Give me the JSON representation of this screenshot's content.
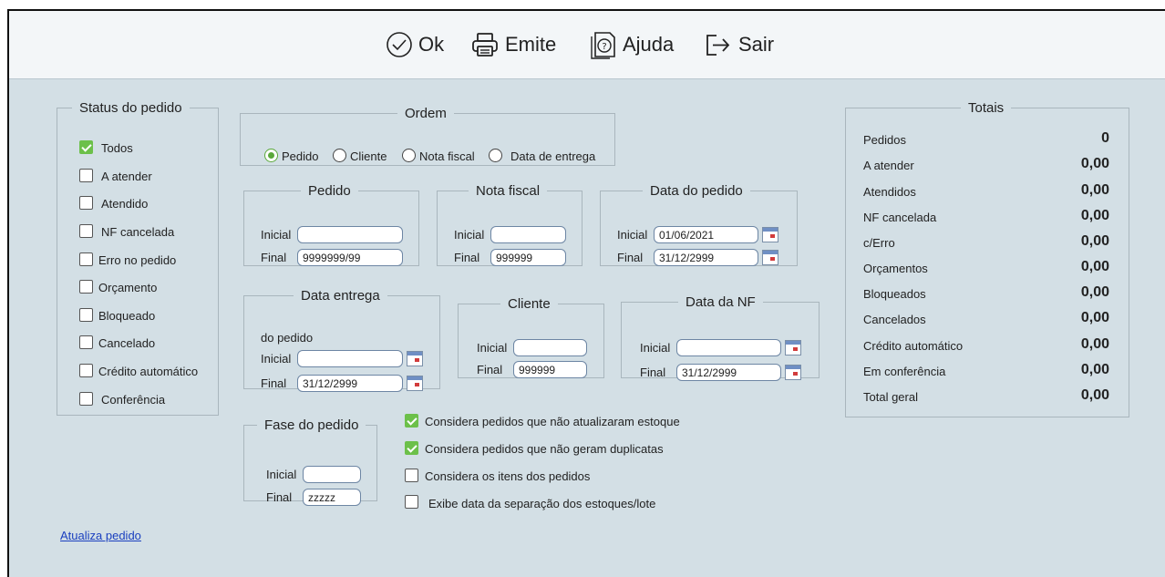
{
  "toolbar": {
    "ok": "Ok",
    "emite": "Emite",
    "ajuda": "Ajuda",
    "sair": "Sair"
  },
  "status": {
    "legend": "Status do pedido",
    "items": [
      {
        "label": "Todos",
        "checked": true
      },
      {
        "label": "A atender",
        "checked": false
      },
      {
        "label": "Atendido",
        "checked": false
      },
      {
        "label": "NF cancelada",
        "checked": false
      },
      {
        "label": "Erro no pedido",
        "checked": false
      },
      {
        "label": "Orçamento",
        "checked": false
      },
      {
        "label": "Bloqueado",
        "checked": false
      },
      {
        "label": "Cancelado",
        "checked": false
      },
      {
        "label": "Crédito automático",
        "checked": false
      },
      {
        "label": "Conferência",
        "checked": false
      }
    ]
  },
  "ordem": {
    "legend": "Ordem",
    "options": [
      "Pedido",
      "Cliente",
      "Nota fiscal",
      "Data de entrega"
    ],
    "selected": "Pedido"
  },
  "pedido": {
    "legend": "Pedido",
    "inicial_label": "Inicial",
    "final_label": "Final",
    "inicial": "",
    "final": "9999999/99"
  },
  "nota_fiscal": {
    "legend": "Nota fiscal",
    "inicial_label": "Inicial",
    "final_label": "Final",
    "inicial": "",
    "final": "999999"
  },
  "data_pedido": {
    "legend": "Data do pedido",
    "inicial_label": "Inicial",
    "final_label": "Final",
    "inicial": "01/06/2021",
    "final": "31/12/2999"
  },
  "data_entrega": {
    "legend": "Data entrega",
    "sub_label": "do pedido",
    "inicial_label": "Inicial",
    "final_label": "Final",
    "inicial": "",
    "final": "31/12/2999"
  },
  "cliente": {
    "legend": "Cliente",
    "inicial_label": "Inicial",
    "final_label": "Final",
    "inicial": "",
    "final": "999999"
  },
  "data_nf": {
    "legend": "Data da NF",
    "inicial_label": "Inicial",
    "final_label": "Final",
    "inicial": "",
    "final": "31/12/2999"
  },
  "fase": {
    "legend": "Fase do pedido",
    "inicial_label": "Inicial",
    "final_label": "Final",
    "inicial": "",
    "final": "zzzzz"
  },
  "options": [
    {
      "label": "Considera pedidos que não atualizaram estoque",
      "checked": true
    },
    {
      "label": "Considera pedidos que não geram duplicatas",
      "checked": true
    },
    {
      "label": "Considera os itens dos pedidos",
      "checked": false
    },
    {
      "label": "Exibe data da separação dos estoques/lote",
      "checked": false
    }
  ],
  "totais": {
    "legend": "Totais",
    "rows": [
      {
        "label": "Pedidos",
        "value": "0"
      },
      {
        "label": "A atender",
        "value": "0,00"
      },
      {
        "label": "Atendidos",
        "value": "0,00"
      },
      {
        "label": "NF cancelada",
        "value": "0,00"
      },
      {
        "label": "c/Erro",
        "value": "0,00"
      },
      {
        "label": "Orçamentos",
        "value": "0,00"
      },
      {
        "label": "Bloqueados",
        "value": "0,00"
      },
      {
        "label": "Cancelados",
        "value": "0,00"
      },
      {
        "label": "Crédito automático",
        "value": "0,00"
      },
      {
        "label": "Em conferência",
        "value": "0,00"
      },
      {
        "label": "Total geral",
        "value": "0,00"
      }
    ]
  },
  "link": {
    "atualiza": "Atualiza pedido"
  },
  "colors": {
    "background": "#d3dfe5",
    "toolbar": "#f3f6f8",
    "check_green": "#6cc04a",
    "link": "#1a3fbf"
  }
}
